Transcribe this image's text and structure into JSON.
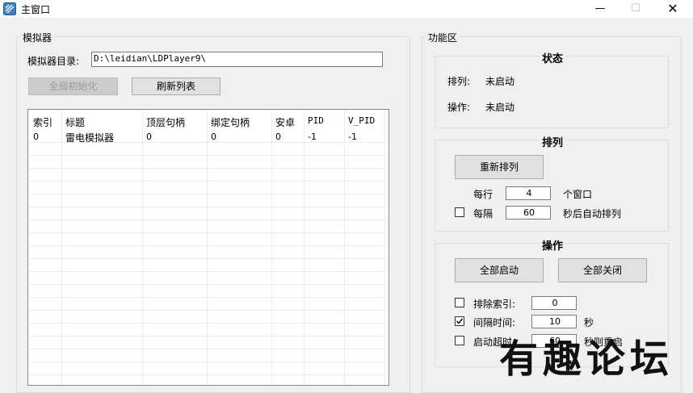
{
  "window": {
    "title": "主窗口",
    "controls": {
      "minimize": "—",
      "maximize": "☐",
      "close": "✕"
    }
  },
  "emulator": {
    "group_label": "模拟器",
    "dir_label": "模拟器目录:",
    "dir_value": "D:\\leidian\\LDPlayer9\\",
    "init_button": "全局初始化",
    "refresh_button": "刷新列表",
    "table": {
      "columns": [
        "索引",
        "标题",
        "顶层句柄",
        "绑定句柄",
        "安卓",
        "PID",
        "V_PID"
      ],
      "rows": [
        [
          "0",
          "雷电模拟器",
          "0",
          "0",
          "0",
          "-1",
          "-1"
        ]
      ]
    }
  },
  "function_area": {
    "group_label": "功能区",
    "status": {
      "title": "状态",
      "arrange_label": "排列:",
      "arrange_value": "未启动",
      "operate_label": "操作:",
      "operate_value": "未启动"
    },
    "arrange": {
      "title": "排列",
      "rearrange_button": "重新排列",
      "per_row_label": "每行",
      "per_row_value": "4",
      "per_row_unit": "个窗口",
      "interval_label": "每隔",
      "interval_value": "60",
      "interval_unit": "秒后自动排列",
      "interval_checked": false
    },
    "operation": {
      "title": "操作",
      "start_all_button": "全部启动",
      "close_all_button": "全部关闭",
      "exclude_label": "排除索引:",
      "exclude_value": "0",
      "exclude_checked": false,
      "gap_label": "间隔时间:",
      "gap_value": "10",
      "gap_unit": "秒",
      "gap_checked": true,
      "timeout_label": "启动超时",
      "timeout_value": "60",
      "timeout_unit": "秒则重启",
      "timeout_checked": false
    }
  },
  "watermark": {
    "text": [
      "有",
      "趣",
      "论",
      "坛"
    ]
  }
}
